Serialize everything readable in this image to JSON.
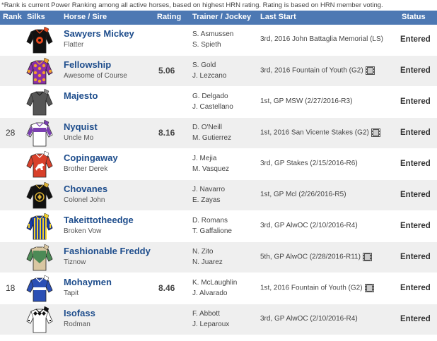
{
  "note": "*Rank is current Power Ranking among all active horses, based on highest HRN rating. Rating is based on HRN member voting.",
  "header": {
    "rank": "Rank",
    "silks": "Silks",
    "horse": "Horse / Sire",
    "rating": "Rating",
    "trainer": "Trainer / Jockey",
    "last": "Last Start",
    "status": "Status"
  },
  "rows": [
    {
      "rank": "",
      "horse": "Sawyers Mickey",
      "sire": "Flatter",
      "rating": "",
      "trainer": "S. Asmussen",
      "jockey": "S. Spieth",
      "last": "3rd, 2016 John Battaglia Memorial (LS)",
      "video": false,
      "status": "Entered",
      "silk": "black-orange-circle"
    },
    {
      "rank": "",
      "horse": "Fellowship",
      "sire": "Awesome of Course",
      "rating": "5.06",
      "trainer": "S. Gold",
      "jockey": "J. Lezcano",
      "last": "3rd, 2016 Fountain of Youth (G2)",
      "video": true,
      "status": "Entered",
      "silk": "purple-orange-dots"
    },
    {
      "rank": "",
      "horse": "Majesto",
      "sire": "",
      "rating": "",
      "trainer": "G. Delgado",
      "jockey": "J. Castellano",
      "last": "1st, GP MSW (2/27/2016-R3)",
      "video": false,
      "status": "Entered",
      "silk": "gray"
    },
    {
      "rank": "28",
      "horse": "Nyquist",
      "sire": "Uncle Mo",
      "rating": "8.16",
      "trainer": "D. O'Neill",
      "jockey": "M. Gutierrez",
      "last": "1st, 2016 San Vicente Stakes (G2)",
      "video": true,
      "status": "Entered",
      "silk": "purple-white"
    },
    {
      "rank": "",
      "horse": "Copingaway",
      "sire": "Brother Derek",
      "rating": "",
      "trainer": "J. Mejia",
      "jockey": "M. Vasquez",
      "last": "3rd, GP Stakes (2/15/2016-R6)",
      "video": false,
      "status": "Entered",
      "silk": "red-horse"
    },
    {
      "rank": "",
      "horse": "Chovanes",
      "sire": "Colonel John",
      "rating": "",
      "trainer": "J. Navarro",
      "jockey": "E. Zayas",
      "last": "1st, GP Mcl (2/26/2016-R5)",
      "video": false,
      "status": "Entered",
      "silk": "black-gold-emblem"
    },
    {
      "rank": "",
      "horse": "Takeittotheedge",
      "sire": "Broken Vow",
      "rating": "",
      "trainer": "D. Romans",
      "jockey": "T. Gaffalione",
      "last": "3rd, GP AlwOC (2/10/2016-R4)",
      "video": false,
      "status": "Entered",
      "silk": "blue-yellow-stripes"
    },
    {
      "rank": "",
      "horse": "Fashionable Freddy",
      "sire": "Tiznow",
      "rating": "",
      "trainer": "N. Zito",
      "jockey": "N. Juarez",
      "last": "5th, GP AlwOC (2/28/2016-R11)",
      "video": true,
      "status": "Entered",
      "silk": "green-tan"
    },
    {
      "rank": "18",
      "horse": "Mohaymen",
      "sire": "Tapit",
      "rating": "8.46",
      "trainer": "K. McLaughlin",
      "jockey": "J. Alvarado",
      "last": "1st, 2016 Fountain of Youth (G2)",
      "video": true,
      "status": "Entered",
      "silk": "royal-blue-white"
    },
    {
      "rank": "",
      "horse": "Isofass",
      "sire": "Rodman",
      "rating": "",
      "trainer": "F. Abbott",
      "jockey": "J. Leparoux",
      "last": "3rd, GP AlwOC (2/10/2016-R4)",
      "video": false,
      "status": "Entered",
      "silk": "white-black-diamonds"
    }
  ],
  "colors": {
    "header_bg": "#4d78b3",
    "horse_name": "#1e4d8c",
    "row_alt": "#efefef"
  }
}
